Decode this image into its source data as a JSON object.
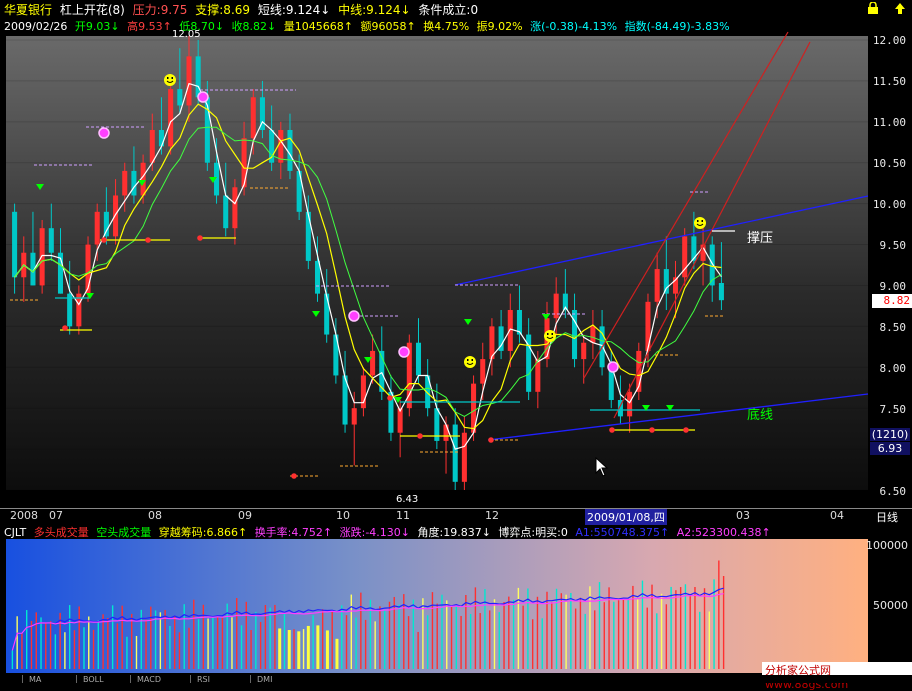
{
  "header": {
    "stock_name": "华夏银行",
    "indicator": "杠上开花(8)",
    "pressure": "压力:9.75",
    "support": "支撑:8.69",
    "short_line": "短线:9.124↓",
    "mid_line": "中线:9.124↓",
    "condition": "条件成立:0",
    "lock_icon": "lock-icon"
  },
  "quote": {
    "date": "2009/02/26",
    "open": "开9.03↓",
    "high": "高9.53↑",
    "low": "低8.70↓",
    "close": "收8.82↓",
    "volume": "量1045668↑",
    "amount": "额96058↑",
    "turnover": "换4.75%",
    "amplitude": "振9.02%",
    "change": "涨(-0.38)-4.13%",
    "index": "指数(-84.49)-3.83%"
  },
  "price_axis": [
    "12.00",
    "11.50",
    "11.00",
    "10.50",
    "10.00",
    "9.50",
    "9.00",
    "8.50",
    "8.00",
    "7.50",
    "7.00",
    "6.50"
  ],
  "current_price": "8.82",
  "counter": "(1210)",
  "counter_price": "6.93",
  "peak_label": "12.05",
  "low_label": "6.43",
  "annotations": {
    "resistance": "撑压",
    "bottom": "底线"
  },
  "date_axis": {
    "y2008": "2008",
    "m07": "07",
    "m08": "08",
    "m09": "09",
    "m10": "10",
    "m11": "11",
    "m12": "12",
    "cursor_date": "2009/01/08,四",
    "m03": "03",
    "m04": "04",
    "period": "日线"
  },
  "volume_panel": {
    "name": "CJLT",
    "many_heads": "多头成交量",
    "empty_heads": "空头成交量",
    "chips": "穿越筹码:6.866↑",
    "hand_rate": "换手率:4.752↑",
    "rise_fall": "涨跌:-4.130↓",
    "angle": "角度:19.837↓",
    "game_point": "博弈点:明买:0",
    "a1": "A1:550748.375↑",
    "a2": "A2:523300.438↑",
    "axis_100000": "100000",
    "axis_50000": "50000"
  },
  "footer": {
    "website": "分析家公式网www.88gs.com"
  },
  "bottom_tabs": [
    "MA",
    "BOLL",
    "MACD",
    "RSI",
    "DMI"
  ],
  "colors": {
    "up": "#ff3030",
    "down": "#00c8c8",
    "blue_line": "#2020ff",
    "yellow": "#ffff00",
    "green": "#00ff00",
    "magenta": "#ff40ff"
  },
  "chart_data": {
    "type": "candlestick",
    "price_ylim": [
      6.3,
      12.05
    ],
    "candles": [
      [
        9.9,
        10.0,
        8.9,
        9.1
      ],
      [
        9.1,
        9.6,
        8.8,
        9.4
      ],
      [
        9.4,
        9.9,
        9.0,
        9.0
      ],
      [
        9.0,
        9.8,
        8.9,
        9.7
      ],
      [
        9.7,
        10.0,
        9.3,
        9.4
      ],
      [
        9.4,
        9.7,
        8.9,
        8.9
      ],
      [
        8.9,
        9.3,
        8.4,
        8.5
      ],
      [
        8.5,
        9.0,
        8.4,
        8.9
      ],
      [
        8.9,
        9.6,
        8.8,
        9.5
      ],
      [
        9.5,
        10.0,
        9.3,
        9.9
      ],
      [
        9.9,
        10.2,
        9.5,
        9.6
      ],
      [
        9.6,
        10.3,
        9.5,
        10.1
      ],
      [
        10.1,
        10.5,
        9.9,
        10.4
      ],
      [
        10.4,
        10.7,
        10.0,
        10.1
      ],
      [
        10.1,
        10.6,
        10.0,
        10.5
      ],
      [
        10.5,
        11.1,
        10.4,
        10.9
      ],
      [
        10.9,
        11.3,
        10.6,
        10.7
      ],
      [
        10.7,
        11.5,
        10.6,
        11.4
      ],
      [
        11.4,
        11.9,
        11.1,
        11.2
      ],
      [
        11.2,
        12.05,
        11.0,
        11.8
      ],
      [
        11.8,
        12.0,
        11.2,
        11.3
      ],
      [
        11.3,
        11.5,
        10.4,
        10.5
      ],
      [
        10.5,
        10.8,
        10.0,
        10.1
      ],
      [
        10.1,
        10.5,
        9.6,
        9.7
      ],
      [
        9.7,
        10.3,
        9.5,
        10.2
      ],
      [
        10.2,
        11.0,
        10.1,
        10.8
      ],
      [
        10.8,
        11.4,
        10.6,
        11.3
      ],
      [
        11.3,
        11.5,
        10.8,
        10.9
      ],
      [
        10.9,
        11.2,
        10.4,
        10.5
      ],
      [
        10.5,
        11.0,
        10.3,
        10.9
      ],
      [
        10.9,
        11.1,
        10.3,
        10.4
      ],
      [
        10.4,
        10.6,
        9.8,
        9.9
      ],
      [
        9.9,
        10.1,
        9.2,
        9.3
      ],
      [
        9.3,
        9.6,
        8.8,
        8.9
      ],
      [
        8.9,
        9.2,
        8.3,
        8.4
      ],
      [
        8.4,
        8.6,
        7.8,
        7.9
      ],
      [
        7.9,
        8.2,
        7.2,
        7.3
      ],
      [
        7.3,
        7.7,
        6.8,
        7.5
      ],
      [
        7.5,
        8.0,
        7.4,
        7.9
      ],
      [
        7.9,
        8.4,
        7.8,
        8.2
      ],
      [
        8.2,
        8.5,
        7.6,
        7.7
      ],
      [
        7.7,
        7.9,
        7.1,
        7.2
      ],
      [
        7.2,
        7.6,
        6.9,
        7.5
      ],
      [
        7.5,
        8.4,
        7.4,
        8.3
      ],
      [
        8.3,
        8.6,
        7.8,
        7.9
      ],
      [
        7.9,
        8.1,
        7.4,
        7.5
      ],
      [
        7.5,
        7.8,
        7.0,
        7.1
      ],
      [
        7.1,
        7.4,
        6.7,
        7.3
      ],
      [
        7.3,
        7.5,
        6.43,
        6.6
      ],
      [
        6.6,
        7.4,
        6.5,
        7.2
      ],
      [
        7.2,
        7.9,
        7.1,
        7.8
      ],
      [
        7.8,
        8.3,
        7.6,
        8.1
      ],
      [
        8.1,
        8.6,
        7.9,
        8.5
      ],
      [
        8.5,
        8.7,
        8.1,
        8.2
      ],
      [
        8.2,
        8.9,
        8.0,
        8.7
      ],
      [
        8.7,
        9.0,
        8.3,
        8.4
      ],
      [
        8.4,
        8.6,
        7.6,
        7.7
      ],
      [
        7.7,
        8.2,
        7.5,
        8.1
      ],
      [
        8.1,
        8.8,
        8.0,
        8.6
      ],
      [
        8.6,
        9.1,
        8.4,
        8.9
      ],
      [
        8.9,
        9.2,
        8.6,
        8.7
      ],
      [
        8.7,
        8.9,
        8.0,
        8.1
      ],
      [
        8.1,
        8.4,
        7.8,
        8.3
      ],
      [
        8.3,
        8.7,
        8.1,
        8.5
      ],
      [
        8.5,
        8.7,
        7.9,
        8.0
      ],
      [
        8.0,
        8.2,
        7.5,
        7.6
      ],
      [
        7.6,
        7.9,
        7.3,
        7.4
      ],
      [
        7.4,
        7.8,
        7.2,
        7.7
      ],
      [
        7.7,
        8.3,
        7.6,
        8.2
      ],
      [
        8.2,
        8.9,
        8.0,
        8.8
      ],
      [
        8.8,
        9.4,
        8.6,
        9.2
      ],
      [
        9.2,
        9.6,
        8.7,
        8.9
      ],
      [
        8.9,
        9.3,
        8.6,
        9.1
      ],
      [
        9.1,
        9.7,
        9.0,
        9.6
      ],
      [
        9.6,
        9.9,
        9.2,
        9.3
      ],
      [
        9.3,
        9.75,
        9.0,
        9.5
      ],
      [
        9.5,
        9.6,
        8.8,
        9.0
      ],
      [
        9.03,
        9.53,
        8.7,
        8.82
      ]
    ],
    "volume_ylim": [
      0,
      120000
    ]
  }
}
